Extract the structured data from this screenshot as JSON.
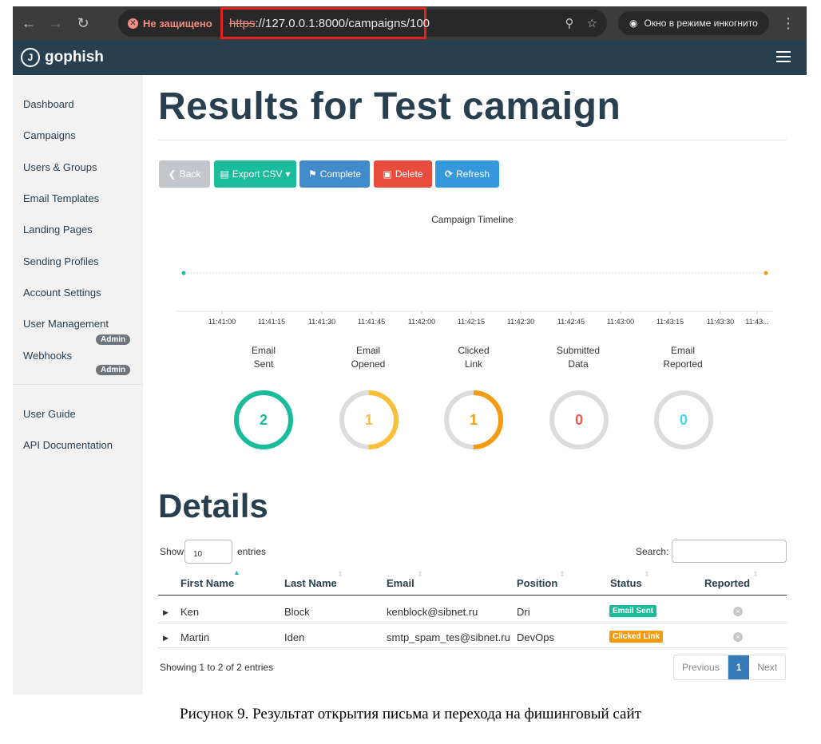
{
  "browser": {
    "security_label": "Не защищено",
    "url_scheme": "https",
    "url_rest": "://127.0.0.1:8000/campaigns/100",
    "incognito_label": "Окно в режиме инкогнито"
  },
  "app": {
    "logo_text": "gophish"
  },
  "sidebar": {
    "items": [
      "Dashboard",
      "Campaigns",
      "Users & Groups",
      "Email Templates",
      "Landing Pages",
      "Sending Profiles",
      "Account Settings",
      "User Management",
      "Webhooks"
    ],
    "admin_badge": "Admin",
    "footer_items": [
      "User Guide",
      "API Documentation"
    ]
  },
  "page": {
    "title": "Results for Test camaign"
  },
  "toolbar": {
    "back": "Back",
    "export": "Export CSV",
    "complete": "Complete",
    "delete": "Delete",
    "refresh": "Refresh"
  },
  "timeline": {
    "title": "Campaign Timeline",
    "ticks": [
      "11:41:00",
      "11:41:15",
      "11:41:30",
      "11:41:45",
      "11:42:00",
      "11:42:15",
      "11:42:30",
      "11:42:45",
      "11:43:00",
      "11:43:15",
      "11:43:30",
      "11:43..."
    ]
  },
  "stats": [
    {
      "label1": "Email",
      "label2": "Sent",
      "value": "2",
      "fraction": 1.0,
      "color": "#1abc9c"
    },
    {
      "label1": "Email",
      "label2": "Opened",
      "value": "1",
      "fraction": 0.5,
      "color": "#f9bf3b"
    },
    {
      "label1": "Clicked",
      "label2": "Link",
      "value": "1",
      "fraction": 0.5,
      "color": "#f39c12"
    },
    {
      "label1": "Submitted",
      "label2": "Data",
      "value": "0",
      "fraction": 0,
      "color": "#f05b4f"
    },
    {
      "label1": "Email",
      "label2": "Reported",
      "value": "0",
      "fraction": 0,
      "color": "#45d6ef"
    }
  ],
  "details": {
    "title": "Details",
    "show_label": "Show",
    "entries_label": "entries",
    "page_size": "10",
    "search_label": "Search:",
    "columns": [
      "First Name",
      "Last Name",
      "Email",
      "Position",
      "Status",
      "Reported"
    ],
    "rows": [
      {
        "first": "Ken",
        "last": "Block",
        "email": "kenblock@sibnet.ru",
        "position": "Dri",
        "status": "Email Sent",
        "status_color": "#1abc9c"
      },
      {
        "first": "Martin",
        "last": "Iden",
        "email": "smtp_spam_tes@sibnet.ru",
        "position": "DevOps",
        "status": "Clicked Link",
        "status_color": "#f39c12"
      }
    ],
    "showing": "Showing 1 to 2 of 2 entries",
    "pager": {
      "prev": "Previous",
      "current": "1",
      "next": "Next"
    }
  },
  "caption": "Рисунок 9. Результат открытия письма и перехода на фишинговый сайт"
}
